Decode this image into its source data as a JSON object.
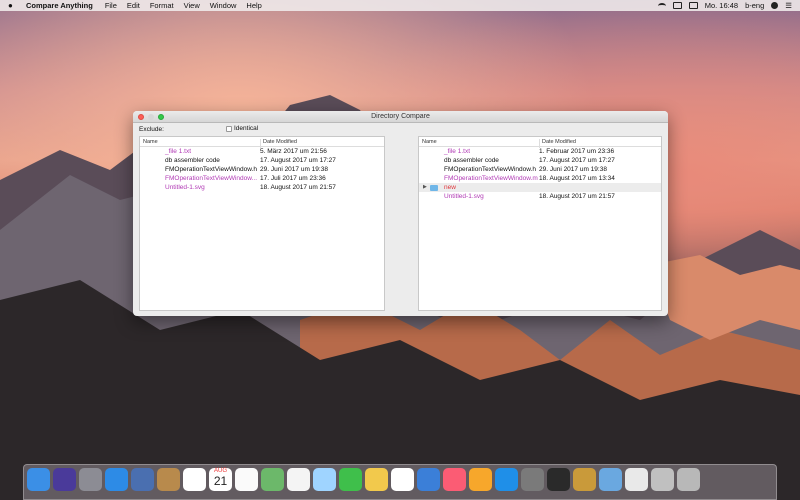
{
  "menubar": {
    "app_name": "Compare Anything",
    "menus": [
      "File",
      "Edit",
      "Format",
      "View",
      "Window",
      "Help"
    ],
    "clock": "Mo. 16:48",
    "user": "b-eng"
  },
  "window": {
    "title": "Directory Compare",
    "exclude_label": "Exclude:",
    "identical_label": "Identical",
    "identical_checked": false,
    "col_name": "Name",
    "col_date": "Date Modified",
    "left_rows": [
      {
        "name": "_file 1.txt",
        "date": "5. März 2017 um 21:56",
        "color": "#b13ab5"
      },
      {
        "name": "db assembler code",
        "date": "17. August 2017 um 17:27",
        "color": "#111111"
      },
      {
        "name": "FMOperationTextViewWindow.h",
        "date": "29. Juni 2017 um 19:38",
        "color": "#111111"
      },
      {
        "name": "FMOperationTextViewWindow...",
        "date": "17. Juli 2017 um 23:36",
        "color": "#b13ab5"
      },
      {
        "name": "Untitled-1.svg",
        "date": "18. August 2017 um 21:57",
        "color": "#b13ab5"
      }
    ],
    "right_rows": [
      {
        "name": "_file 1.txt",
        "date": "1. Februar 2017 um 23:36",
        "color": "#b13ab5"
      },
      {
        "name": "db assembler code",
        "date": "17. August 2017 um 17:27",
        "color": "#111111"
      },
      {
        "name": "FMOperationTextViewWindow.h",
        "date": "29. Juni 2017 um 19:38",
        "color": "#111111"
      },
      {
        "name": "FMOperationTextViewWindow.m",
        "date": "18. August 2017 um 13:34",
        "color": "#b13ab5"
      },
      {
        "name": "new",
        "date": "",
        "color": "#e0353b",
        "folder": true
      },
      {
        "name": "Untitled-1.svg",
        "date": "18. August 2017 um 21:57",
        "color": "#b13ab5"
      }
    ]
  },
  "dock": {
    "calendar_day": "21",
    "calendar_month": "AUG",
    "icon_colors": [
      "#3b8fe6",
      "#4a3a9a",
      "#8c8c94",
      "#2d8be6",
      "#4a6fb0",
      "#b88a4c",
      "#ffffff",
      "#f6e6a0",
      "#fafafa",
      "#6cb86a",
      "#f4f4f4",
      "#9fd4ff",
      "#3fbf4b",
      "#f2c94c",
      "#ffffff",
      "#3b7fd8",
      "#fb5c74",
      "#f7a72b",
      "#1f8fe8",
      "#7a7a7a",
      "#2a2a2a",
      "#c99a3a",
      "#6aa8e0",
      "#e9e9e9",
      "#c0c0c0",
      "#b8b8b8"
    ]
  }
}
